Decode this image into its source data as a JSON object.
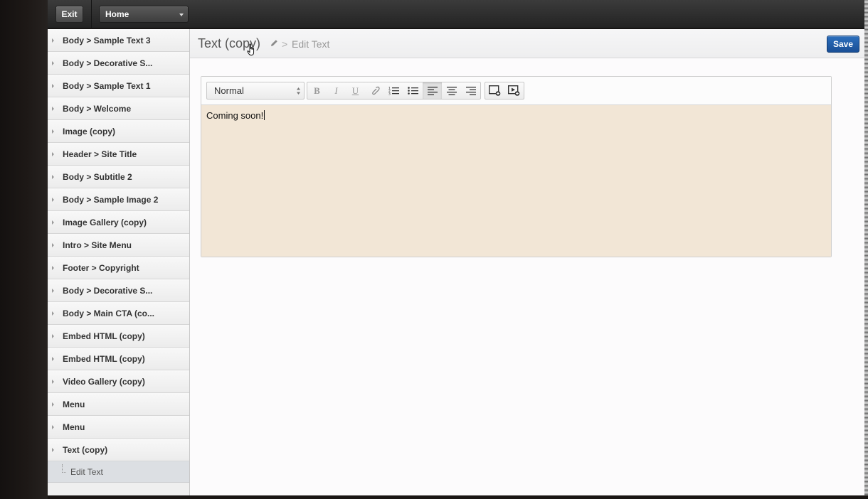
{
  "topbar": {
    "exit_label": "Exit",
    "page_select_value": "Home"
  },
  "sidebar": {
    "items": [
      {
        "label": "Body > Sample Text 3"
      },
      {
        "label": "Body > Decorative S..."
      },
      {
        "label": "Body > Sample Text 1"
      },
      {
        "label": "Body > Welcome"
      },
      {
        "label": "Image (copy)"
      },
      {
        "label": "Header > Site Title"
      },
      {
        "label": "Body > Subtitle 2"
      },
      {
        "label": "Body > Sample Image 2"
      },
      {
        "label": "Image Gallery (copy)"
      },
      {
        "label": "Intro > Site Menu"
      },
      {
        "label": "Footer > Copyright"
      },
      {
        "label": "Body > Decorative S..."
      },
      {
        "label": "Body > Main CTA (co..."
      },
      {
        "label": "Embed HTML (copy)"
      },
      {
        "label": "Embed HTML (copy)"
      },
      {
        "label": "Video Gallery (copy)"
      },
      {
        "label": "Menu"
      },
      {
        "label": "Menu"
      },
      {
        "label": "Text (copy)"
      }
    ],
    "sub_item": "Edit Text"
  },
  "main": {
    "title": "Text (copy)",
    "breadcrumb_sep": ">",
    "breadcrumb_current": "Edit Text",
    "save_label": "Save"
  },
  "editor": {
    "format_value": "Normal",
    "toolbar_icons": [
      "bold-icon",
      "italic-icon",
      "underline-icon",
      "link-icon",
      "ordered-list-icon",
      "bullet-list-icon",
      "align-left-icon",
      "align-center-icon",
      "align-right-icon",
      "insert-image-icon",
      "insert-video-icon"
    ],
    "content": "Coming soon!"
  },
  "colors": {
    "save_button": "#1f5aa6",
    "editor_background": "#f2e6d6",
    "topbar": "#2e2e2e"
  }
}
